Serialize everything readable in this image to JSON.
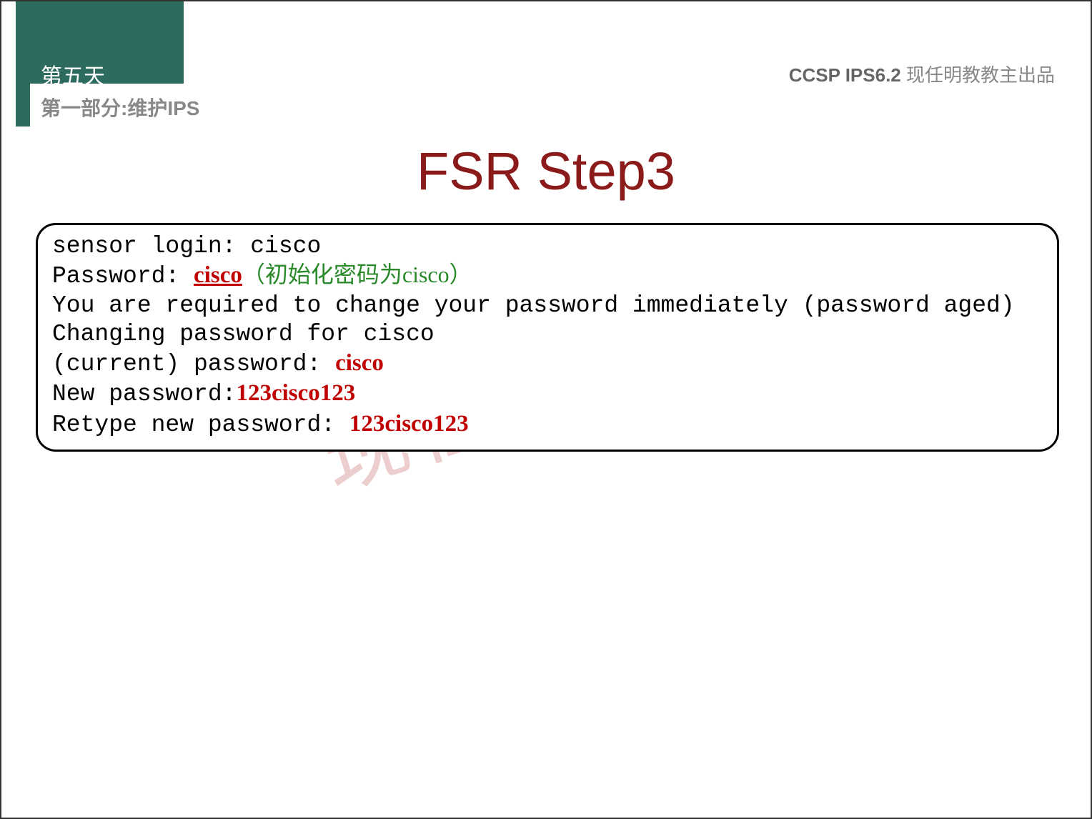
{
  "header": {
    "day_label": "第五天",
    "section_label": "第一部分:维护IPS",
    "course_code": "CCSP IPS6.2",
    "author_note": " 现任明教教主出品"
  },
  "slide_title": "FSR Step3",
  "terminal": {
    "line1_prefix": "sensor login: ",
    "line1_value": "cisco",
    "line2_prefix": "Password: ",
    "line2_value": "cisco",
    "line2_note": "（初始化密码为cisco）",
    "line3": "You are required to change your password immediately (password aged)",
    "line4": "Changing password for cisco",
    "line5_prefix": "(current) password: ",
    "line5_value": "cisco",
    "line6_prefix": "New password:",
    "line6_value": "123cisco123",
    "line7_prefix": "Retype new password: ",
    "line7_value": "123cisco123"
  },
  "watermark": "现任明教教主"
}
